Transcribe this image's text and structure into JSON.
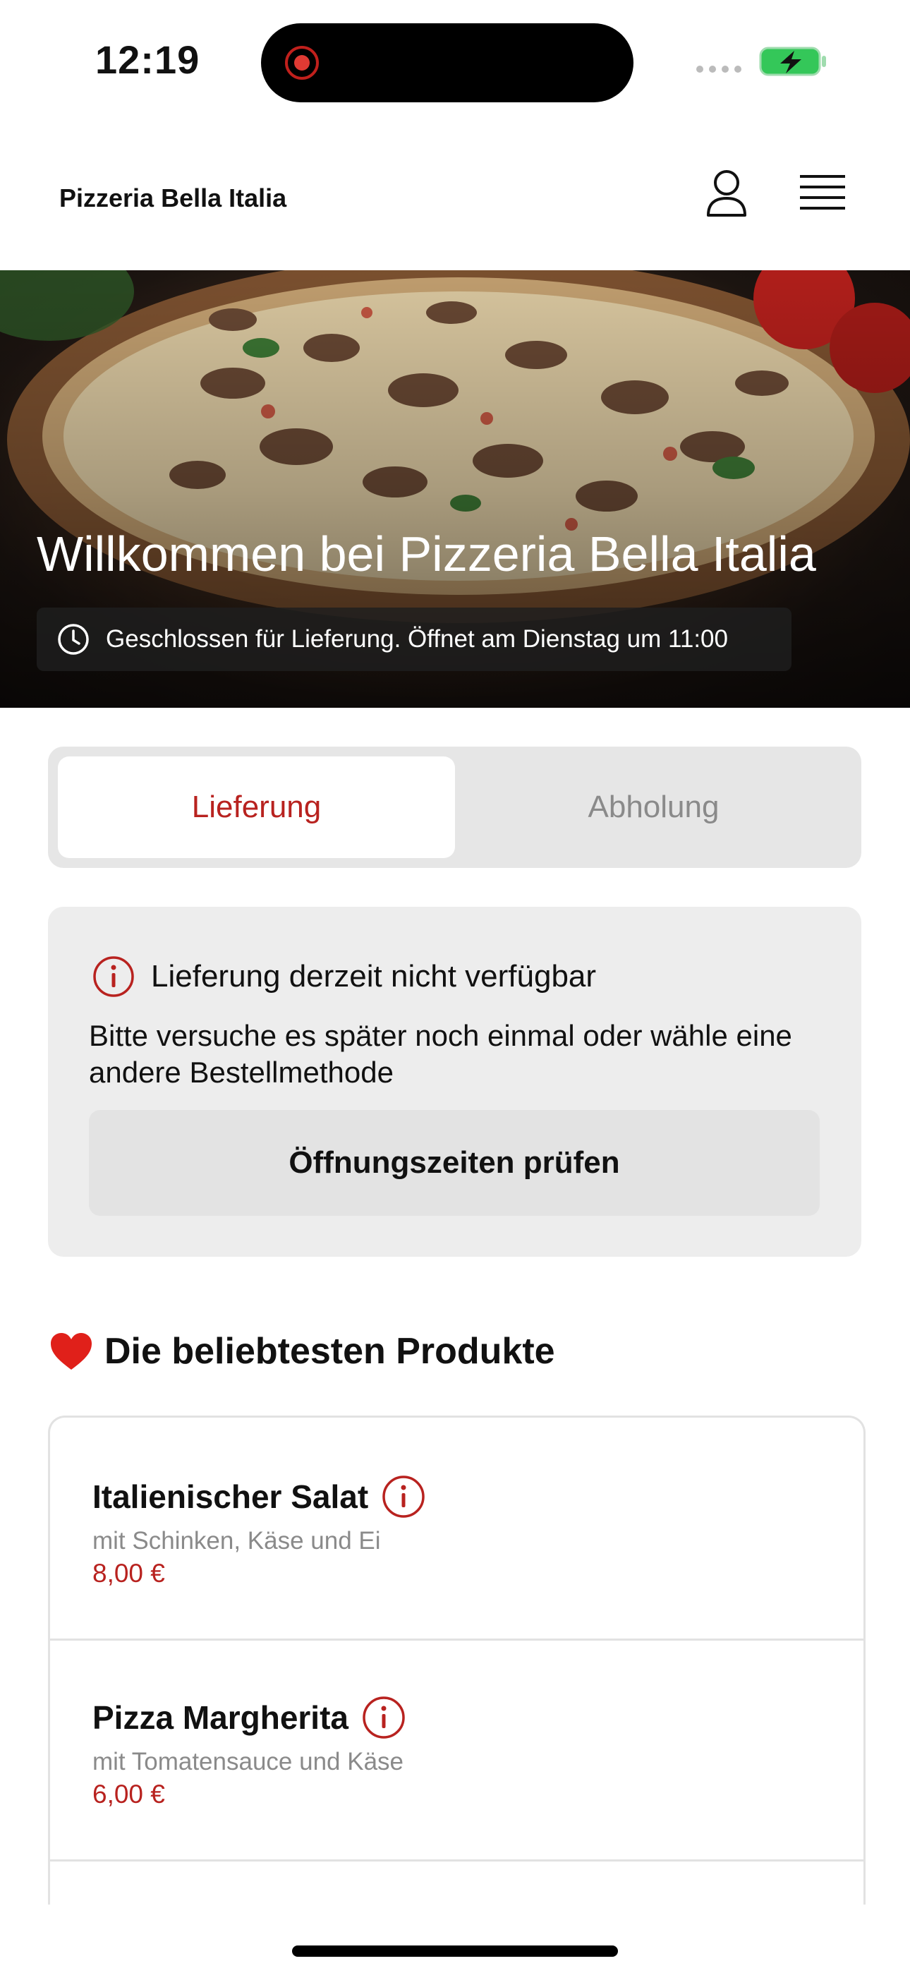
{
  "status_bar": {
    "time": "12:19"
  },
  "header": {
    "brand": "Pizzeria Bella Italia"
  },
  "hero": {
    "title": "Willkommen bei Pizzeria Bella Italia",
    "status": "Geschlossen für Lieferung. Öffnet am Dienstag um 11:00"
  },
  "order_mode": {
    "options": [
      "Lieferung",
      "Abholung"
    ],
    "selected": "Lieferung"
  },
  "notice": {
    "title": "Lieferung derzeit nicht verfügbar",
    "body": "Bitte versuche es später noch einmal oder wähle eine andere Bestellmethode",
    "button": "Öffnungszeiten prüfen"
  },
  "popular": {
    "title": "Die beliebtesten Produkte",
    "items": [
      {
        "name": "Italienischer Salat",
        "description": "mit Schinken, Käse und Ei",
        "price": "8,00 €"
      },
      {
        "name": "Pizza Margherita",
        "description": "mit Tomatensauce und Käse",
        "price": "6,00 €"
      }
    ]
  },
  "colors": {
    "accent": "#b8221f",
    "card_bg": "#ededed",
    "muted_text": "#8a8a8a"
  },
  "icons": [
    "record-icon",
    "signal-icon",
    "battery-charging-icon",
    "user-icon",
    "menu-icon",
    "clock-icon",
    "info-icon",
    "heart-icon"
  ]
}
